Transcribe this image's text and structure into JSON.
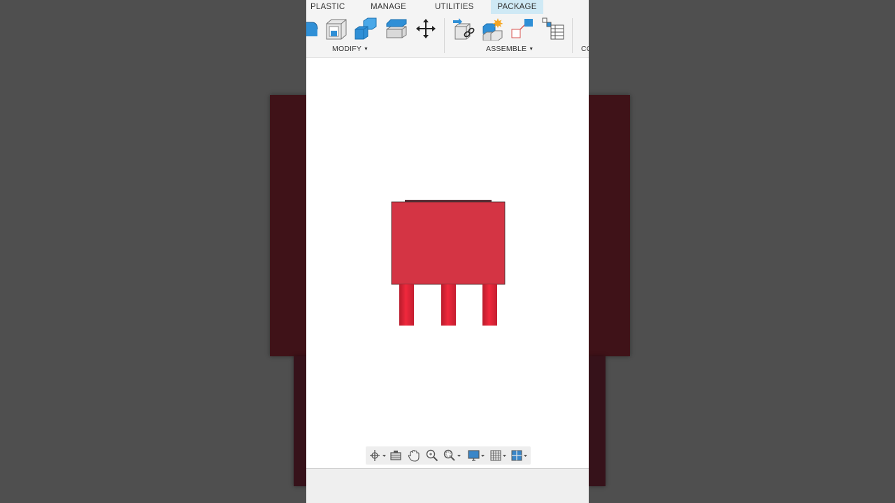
{
  "tabs": [
    {
      "label": "PLASTIC",
      "active": false
    },
    {
      "label": "MANAGE",
      "active": false
    },
    {
      "label": "UTILITIES",
      "active": false
    },
    {
      "label": "PACKAGE",
      "active": true
    }
  ],
  "groups": {
    "modify": {
      "label": "MODIFY"
    },
    "assemble": {
      "label": "ASSEMBLE"
    },
    "construct": {
      "label": "CO"
    }
  },
  "colors": {
    "tab_active": "#cfe9f5",
    "tool_blue": "#2f8fd6",
    "part_red": "#d43444",
    "pin_red": "#e0273a",
    "background": "#4f4f4f"
  },
  "icons": {
    "modify": [
      "fillet-icon",
      "shell-icon",
      "combine-icon",
      "replace-face-icon",
      "move-icon"
    ],
    "assemble": [
      "joint-link-icon",
      "new-component-icon",
      "as-built-joint-icon",
      "component-table-icon"
    ],
    "navbar": [
      "orbit-icon",
      "look-at-icon",
      "pan-icon",
      "zoom-icon",
      "zoom-window-icon",
      "display-settings-icon",
      "grid-settings-icon",
      "viewports-icon"
    ]
  }
}
